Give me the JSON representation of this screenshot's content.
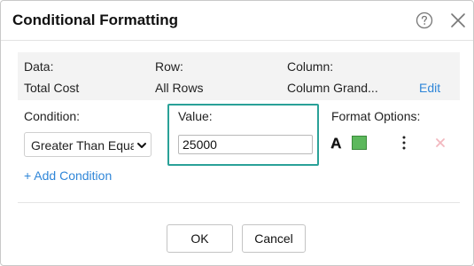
{
  "dialog": {
    "title": "Conditional Formatting"
  },
  "info": {
    "data_label": "Data:",
    "data_value": "Total Cost",
    "row_label": "Row:",
    "row_value": "All Rows",
    "column_label": "Column:",
    "column_value": "Column Grand...",
    "edit_label": "Edit"
  },
  "condition": {
    "label": "Condition:",
    "selected": "Greater Than Equal To"
  },
  "value": {
    "label": "Value:",
    "input_value": "25000"
  },
  "format_options": {
    "label": "Format Options:",
    "font_icon_glyph": "A",
    "fill_color": "#5cb85c",
    "accent_border": "#2aa198"
  },
  "add_condition_label": "+ Add Condition",
  "buttons": {
    "ok": "OK",
    "cancel": "Cancel"
  },
  "icons": {
    "help": "help-icon",
    "close": "close-icon",
    "chevron": "chevron-down-icon",
    "more": "more-options-icon",
    "remove": "remove-condition-icon"
  }
}
